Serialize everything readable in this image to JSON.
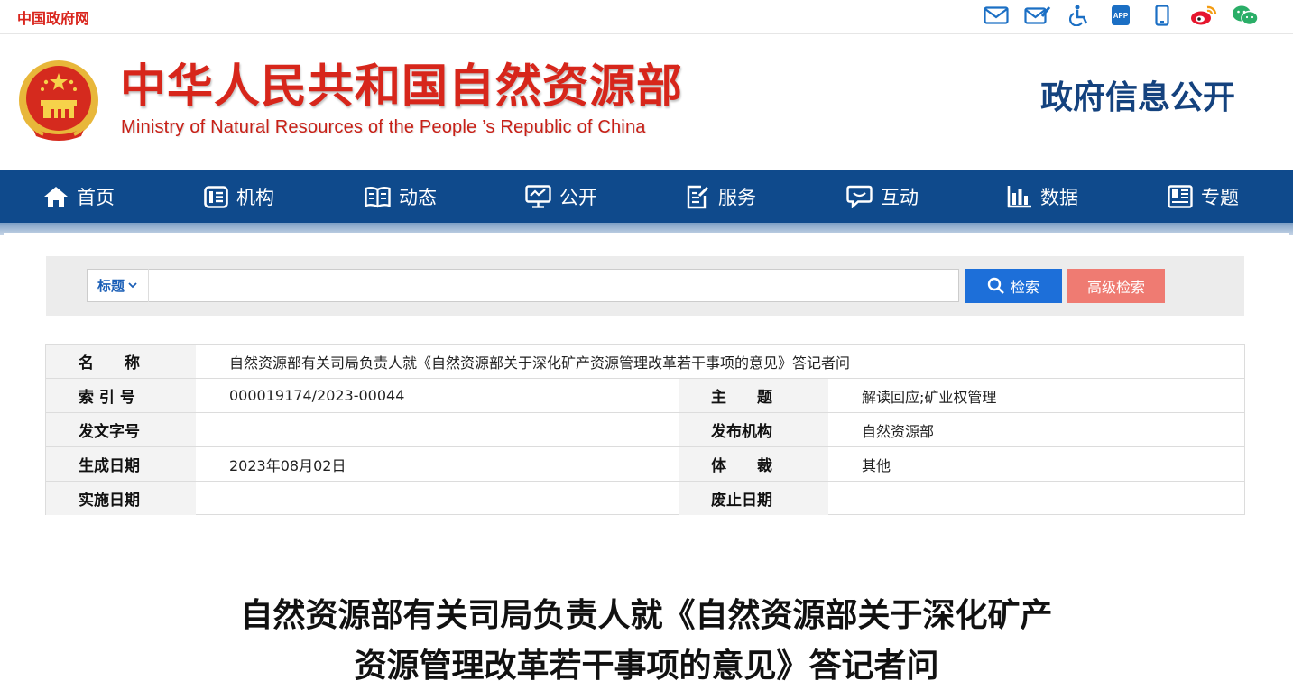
{
  "topbar": {
    "gov_link": "中国政府网",
    "icons": [
      "mail-icon",
      "mail-edit-icon",
      "accessibility-icon",
      "app-icon",
      "mobile-icon",
      "weibo-icon",
      "wechat-icon"
    ]
  },
  "masthead": {
    "title_cn": "中华人民共和国自然资源部",
    "title_en": "Ministry of Natural Resources of the People ’s Republic of China",
    "section": "政府信息公开"
  },
  "nav": {
    "items": [
      {
        "label": "首页",
        "icon": "home-icon"
      },
      {
        "label": "机构",
        "icon": "org-icon"
      },
      {
        "label": "动态",
        "icon": "book-icon"
      },
      {
        "label": "公开",
        "icon": "monitor-icon"
      },
      {
        "label": "服务",
        "icon": "edit-doc-icon"
      },
      {
        "label": "互动",
        "icon": "chat-icon"
      },
      {
        "label": "数据",
        "icon": "bar-chart-icon"
      },
      {
        "label": "专题",
        "icon": "topic-icon"
      }
    ]
  },
  "search": {
    "type_label": "标题",
    "input_value": "",
    "search_button": "检索",
    "advanced_button": "高级检索"
  },
  "info": {
    "name_label": "名　　称",
    "name_value": "自然资源部有关司局负责人就《自然资源部关于深化矿产资源管理改革若干事项的意见》答记者问",
    "index_label": "索 引 号",
    "index_value": "000019174/2023-00044",
    "topic_label": "主　　题",
    "topic_value": "解读回应;矿业权管理",
    "docno_label": "发文字号",
    "docno_value": "",
    "issuer_label": "发布机构",
    "issuer_value": "自然资源部",
    "date_label": "生成日期",
    "date_value": "2023年08月02日",
    "genre_label": "体　　裁",
    "genre_value": "其他",
    "effective_label": "实施日期",
    "effective_value": "",
    "expire_label": "废止日期",
    "expire_value": ""
  },
  "article": {
    "title_line1": "自然资源部有关司局负责人就《自然资源部关于深化矿产",
    "title_line2": "资源管理改革若干事项的意见》答记者问"
  },
  "colors": {
    "brand_red": "#d7261b",
    "nav_blue": "#0f4a8c",
    "section_blue": "#14427e",
    "search_blue": "#1d6fd9",
    "advanced_salmon": "#ef7b72"
  }
}
